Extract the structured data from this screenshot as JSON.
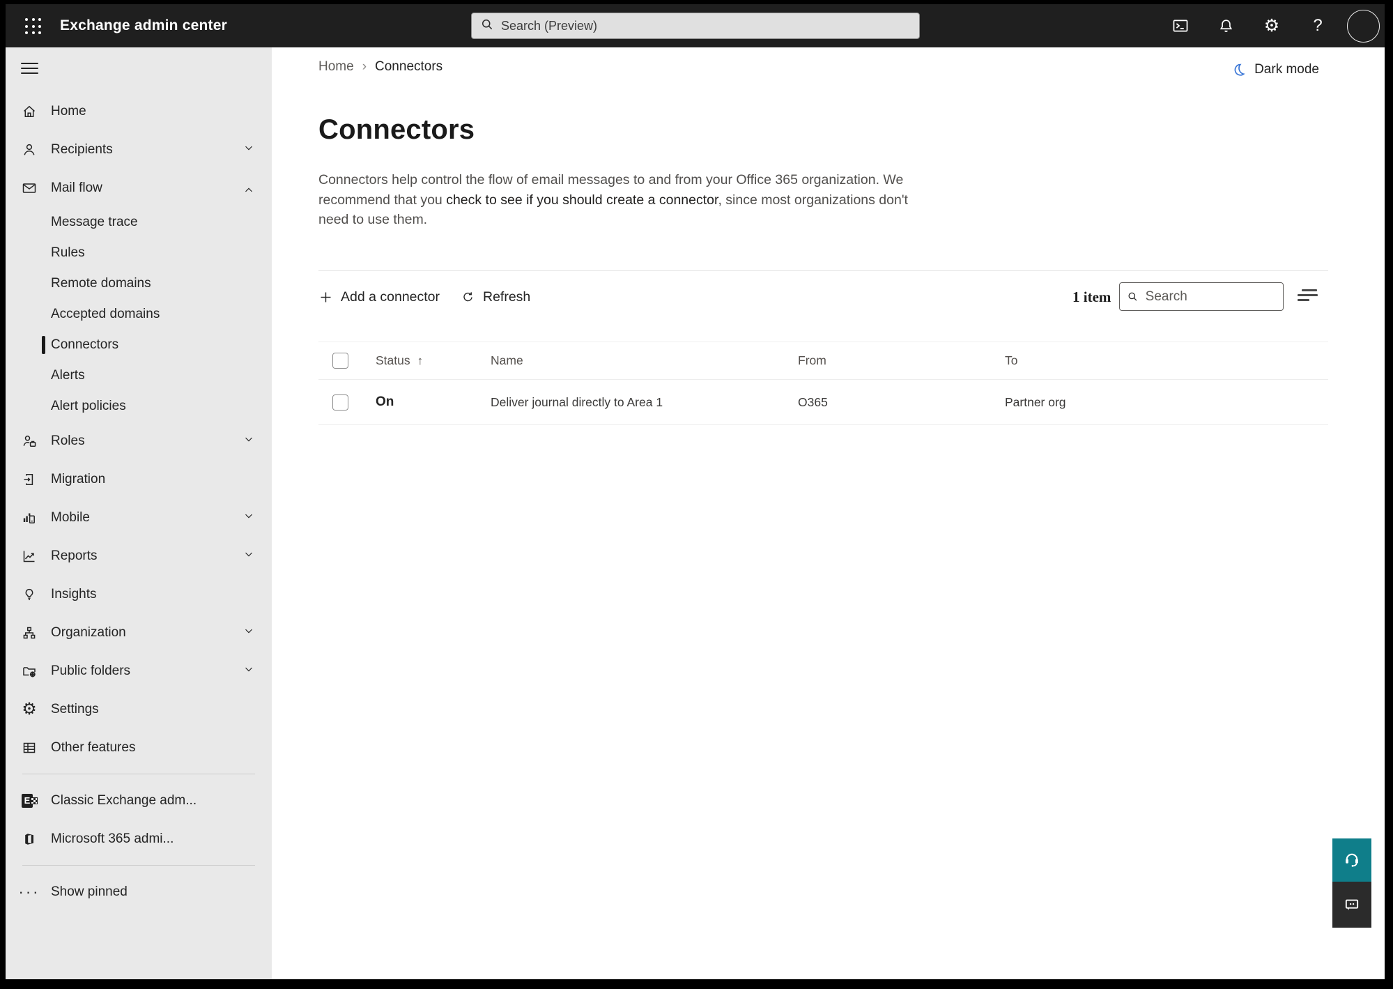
{
  "theme": {
    "topbar_bg": "#1f1f1f",
    "sidebar_bg": "#e9e9e9",
    "accent_teal": "#0f7e8a",
    "feedback_dark": "#2b2b2b",
    "moon_blue": "#3a76d6",
    "selection_black": "#1a1a1a"
  },
  "icons": {
    "app_launcher": "waffle-grid",
    "search": "magnifier",
    "terminal": "powershell-window",
    "notifications": "bell",
    "settings": "gear",
    "help": "question-mark",
    "avatar": "empty-circle",
    "dark_mode": "crescent-moon",
    "add": "plus",
    "refresh": "circular-arrow",
    "filter": "filter-lines",
    "sort_ascending": "up-arrow",
    "support": "headset",
    "feedback": "chat-bubble"
  },
  "topbar": {
    "app_title": "Exchange admin center",
    "search_placeholder": "Search (Preview)"
  },
  "sidebar": {
    "items": [
      {
        "label": "Home"
      },
      {
        "label": "Recipients"
      },
      {
        "label": "Mail flow"
      },
      {
        "label": "Message trace"
      },
      {
        "label": "Rules"
      },
      {
        "label": "Remote domains"
      },
      {
        "label": "Accepted domains"
      },
      {
        "label": "Connectors"
      },
      {
        "label": "Alerts"
      },
      {
        "label": "Alert policies"
      },
      {
        "label": "Roles"
      },
      {
        "label": "Migration"
      },
      {
        "label": "Mobile"
      },
      {
        "label": "Reports"
      },
      {
        "label": "Insights"
      },
      {
        "label": "Organization"
      },
      {
        "label": "Public folders"
      },
      {
        "label": "Settings"
      },
      {
        "label": "Other features"
      },
      {
        "label": "Classic Exchange adm..."
      },
      {
        "label": "Microsoft 365 admi..."
      },
      {
        "label": "Show pinned"
      }
    ]
  },
  "breadcrumb": {
    "home": "Home",
    "separator": "›",
    "current": "Connectors"
  },
  "header_actions": {
    "dark_mode_label": "Dark mode"
  },
  "page": {
    "title": "Connectors",
    "description_before": "Connectors help control the flow of email messages to and from your Office 365 organization. We recommend that you ",
    "description_link": "check to see if you should create a connector",
    "description_after": ", since most organizations don't need to use them."
  },
  "toolbar": {
    "add_label": "Add a connector",
    "refresh_label": "Refresh",
    "item_count": "1 item",
    "search_placeholder": "Search"
  },
  "table": {
    "columns": {
      "status": "Status",
      "name": "Name",
      "from": "From",
      "to": "To"
    },
    "sort_arrow": "↑",
    "rows": [
      {
        "status": "On",
        "name": "Deliver journal directly to Area 1",
        "from": "O365",
        "to": "Partner org"
      }
    ]
  }
}
